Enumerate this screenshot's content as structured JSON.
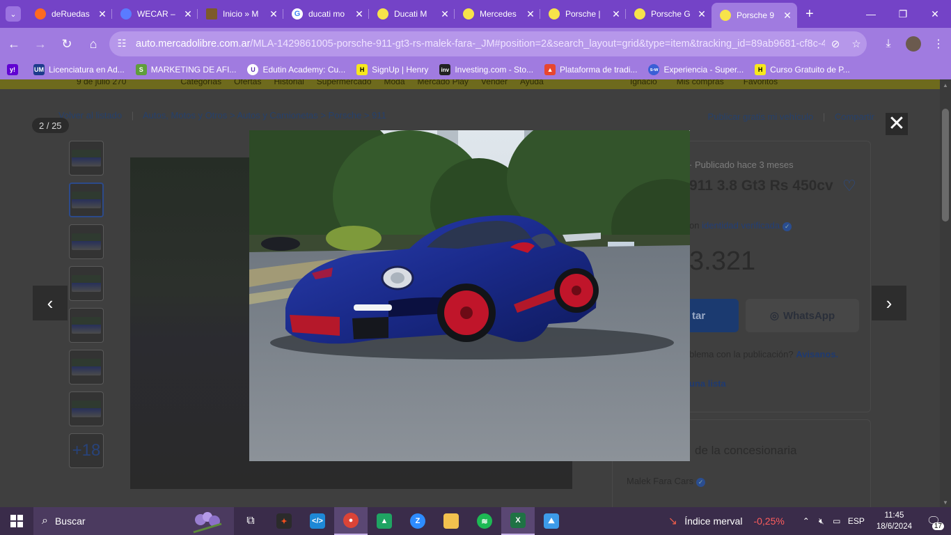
{
  "browser": {
    "tabs": [
      {
        "label": "deRuedas",
        "icon": "firefox-icon",
        "color": "#ff6a1f"
      },
      {
        "label": "WECAR –",
        "icon": "car-outline-icon",
        "color": "#5a7bff"
      },
      {
        "label": "Inicio » M",
        "icon": "maipu-usados-icon",
        "color": "#7d5a2a"
      },
      {
        "label": "ducati mo",
        "icon": "google-icon",
        "color": "#ffffff"
      },
      {
        "label": "Ducati M",
        "icon": "mercadolibre-icon",
        "color": "#f7e34a"
      },
      {
        "label": "Mercedes",
        "icon": "mercadolibre-icon",
        "color": "#f7e34a"
      },
      {
        "label": "Porsche |",
        "icon": "mercadolibre-icon",
        "color": "#f7e34a"
      },
      {
        "label": "Porsche G",
        "icon": "mercadolibre-icon",
        "color": "#f7e34a"
      },
      {
        "label": "Porsche 9",
        "icon": "mercadolibre-icon",
        "color": "#f7e34a",
        "active": true
      }
    ],
    "url_host": "auto.mercadolibre.com.ar",
    "url_path": "/MLA-1429861005-porsche-911-gt3-rs-malek-fara-_JM#position=2&search_layout=grid&type=item&tracking_id=89ab9681-cf8c-4...",
    "bookmarks": [
      {
        "label": "",
        "icon": "yahoo-icon",
        "color": "#6001d2",
        "glyph": "y!"
      },
      {
        "label": "Licenciatura en Ad...",
        "icon": "um-icon",
        "color": "#1d3b8c",
        "glyph": "UM"
      },
      {
        "label": "MARKETING DE AFI...",
        "icon": "shopify-icon",
        "color": "#5f9e3b",
        "glyph": "S"
      },
      {
        "label": "Edutin Academy: Cu...",
        "icon": "edutin-icon",
        "color": "#ffffff",
        "glyph": "U"
      },
      {
        "label": "SignUp | Henry",
        "icon": "henry-icon",
        "color": "#f7e81d",
        "glyph": "H"
      },
      {
        "label": "Investing.com - Sto...",
        "icon": "investing-icon",
        "color": "#222222",
        "glyph": "inv"
      },
      {
        "label": "Plataforma de tradi...",
        "icon": "trading-icon",
        "color": "#e8462f",
        "glyph": "▲"
      },
      {
        "label": "Experiencia - Super...",
        "icon": "superprof-icon",
        "color": "#3a5fd6",
        "glyph": "s-w"
      },
      {
        "label": "Curso Gratuito de P...",
        "icon": "henry-icon",
        "color": "#f7e81d",
        "glyph": "H"
      }
    ]
  },
  "site": {
    "header_left": [
      "9 de julio 270",
      "Categorías",
      "Ofertas",
      "Historial",
      "Supermercado",
      "Moda",
      "Mercado Play",
      "Vender",
      "Ayuda"
    ],
    "header_right": [
      "Ignacio",
      "Mis compras",
      "Favoritos"
    ],
    "back_link": "Volver al listado",
    "breadcrumb": "Autos, Motos y Otros  >  Autos y Camionetas  >  Porsche  >  911",
    "publish_link": "Publicar gratis mi vehículo",
    "share_link": "Compartir",
    "meta": "· Publicado hace 3 meses",
    "title": "911 3.8 Gt3 Rs 450cv",
    "verified_prefix": "on",
    "verified_link": "identidad verificada",
    "price": "3.321",
    "contact_label": "tar",
    "whatsapp_label": "WhatsApp",
    "report_text": "blema con la publicación?",
    "report_link": "Avisanos.",
    "list_link": "una lista",
    "dealer_heading": "de la concesionaria",
    "dealer_name": "Malek Fara Cars",
    "more_photos": "+18"
  },
  "viewer": {
    "counter": "2 / 25",
    "close_label": "✕",
    "prev_label": "‹",
    "next_label": "›"
  },
  "taskbar": {
    "search_placeholder": "Buscar",
    "apps": [
      "task-view-icon",
      "figma-icon",
      "vscode-icon",
      "chrome-icon",
      "google-drive-icon",
      "zoom-icon",
      "file-explorer-icon",
      "spotify-icon",
      "excel-icon",
      "photos-icon"
    ],
    "widget_label": "Índice merval",
    "widget_value": "-0,25%",
    "language": "ESP",
    "time": "11:45",
    "date": "18/6/2024",
    "notifications": "17"
  }
}
